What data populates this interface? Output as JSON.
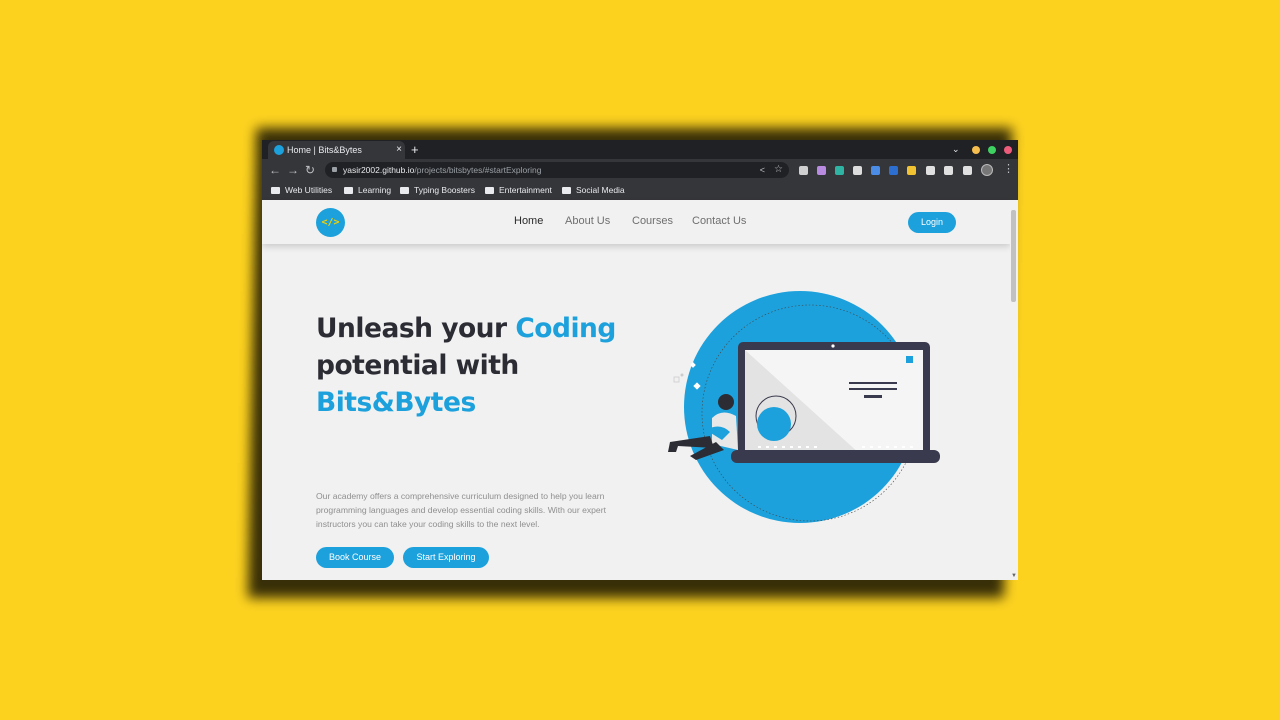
{
  "colors": {
    "background": "#fdd21f",
    "accent": "#1da1dc",
    "heading": "#2c2c34",
    "body_text": "#8f8f8f",
    "chrome_dark": "#202124"
  },
  "browser": {
    "tab": {
      "title": "Home | Bits&Bytes",
      "close": "×"
    },
    "new_tab": "+",
    "tab_search": "⌄",
    "window_buttons": [
      {
        "name": "minimize",
        "color": "#f6be4f"
      },
      {
        "name": "maximize",
        "color": "#3ed061"
      },
      {
        "name": "close",
        "color": "#ed5c7b"
      }
    ],
    "nav": {
      "back": "←",
      "forward": "→",
      "reload": "↻"
    },
    "address": {
      "host": "yasir2002.github.io",
      "path": "/projects/bitsbytes/#startExploring"
    },
    "omnibox_icons": {
      "share": "<",
      "star": "☆"
    },
    "extensions": [
      {
        "name": "ext-screenshot-icon",
        "color": "#d0d0d0"
      },
      {
        "name": "ext-palette-icon",
        "color": "#b98be0"
      },
      {
        "name": "ext-ruler-icon",
        "color": "#2fb4a4"
      },
      {
        "name": "ext-crop-icon",
        "color": "#dddddd"
      },
      {
        "name": "ext-translate-icon",
        "color": "#4b8ce6"
      },
      {
        "name": "ext-pdf-icon",
        "color": "#2d6fd0"
      },
      {
        "name": "ext-emoji-icon",
        "color": "#f1c232"
      },
      {
        "name": "ext-puzzle-icon",
        "color": "#e0e0e0"
      },
      {
        "name": "ext-reading-list-icon",
        "color": "#e0e0e0"
      },
      {
        "name": "ext-side-panel-icon",
        "color": "#e0e0e0"
      }
    ],
    "menu": "⋮",
    "bookmarks": [
      "Web Utilities",
      "Learning",
      "Typing Boosters",
      "Entertainment",
      "Social Media"
    ]
  },
  "site": {
    "logo": "</>",
    "nav": [
      "Home",
      "About Us",
      "Courses",
      "Contact Us"
    ],
    "login": "Login",
    "hero": {
      "line1_pre": "Unleash your ",
      "line1_accent": "Coding",
      "line2": "potential with",
      "line3_accent": "Bits&Bytes",
      "description": "Our academy offers a comprehensive curriculum designed to help you learn programming languages and develop essential coding skills. With our expert instructors you can take your coding skills to the next level.",
      "primary_cta": "Book Course",
      "secondary_cta": "Start Exploring"
    },
    "scroll_arrow": "▼"
  }
}
